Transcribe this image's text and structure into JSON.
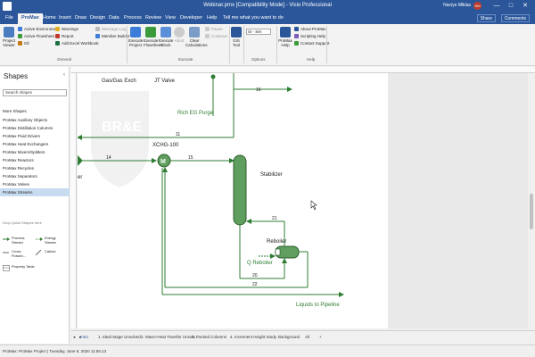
{
  "titlebar": {
    "title": "Webinar.pmx [Compatibility Mode] - Visio Professional",
    "user": "Naciye Miklas",
    "avatar_initials": "NM",
    "min_glyph": "—",
    "max_glyph": "□",
    "close_glyph": "✕"
  },
  "tabs": [
    "File",
    "ProMax",
    "Home",
    "Insert",
    "Draw",
    "Design",
    "Data",
    "Process",
    "Review",
    "View",
    "Developer",
    "Help"
  ],
  "tellme": "Tell me what you want to do",
  "share_label": "Share",
  "comments_label": "Comments",
  "ribbon": {
    "project_viewer": "Project Viewer",
    "active_environment": "Active Environment",
    "active_flowsheet": "Active Flowsheet",
    "oil": "Oil",
    "warnings": "Warnings",
    "report": "Report",
    "add_excel_workbook": "Add Excel Workbook",
    "message_log": "Message Log",
    "member_builder": "Member Builder",
    "general_label": "General",
    "execute_project": "Execute Project",
    "execute_flowsheet": "Execute Flowsheet",
    "execute_block": "Execute Block",
    "abort": "Abort",
    "clear_calculations": "Clear Calculations",
    "pause": "Pause",
    "continue": "Continue",
    "execute_label": "Execute",
    "gis_tool": "GIS Tool",
    "options_select": "SI - Set",
    "options_label": "Options",
    "promax_help": "ProMax Help",
    "about_promax": "About ProMax",
    "scripting_help": "Scripting Help",
    "contact_support": "Contact Support",
    "help_label": "Help"
  },
  "shapes_panel": {
    "title": "Shapes",
    "search_placeholder": "Search shapes",
    "more_shapes": "More Shapes",
    "stencils": [
      "ProMax Auxiliary Objects",
      "ProMax Distillation Columns",
      "ProMax Fluid Drivers",
      "ProMax Heat Exchangers",
      "ProMax Mixers/Splitters",
      "ProMax Reactors",
      "ProMax Recycles",
      "ProMax Separators",
      "ProMax Valves",
      "ProMax Streams"
    ],
    "drop_hint": "Drop Quick Shapes here",
    "master_shapes": [
      "Process Stream",
      "Energy Stream",
      "Cross Flowsh...",
      "Callout",
      "Property Table"
    ]
  },
  "diagram": {
    "labels": {
      "gas_exch": "Gas/Gas Exch",
      "jt_valve": "JT Valve",
      "rich_eg_purge": "Rich EG Purge",
      "xchg": "XCHG-100",
      "stabilizer": "Stabilizer",
      "reboiler": "Reboiler",
      "q_reboiler": "Q Reboiler",
      "liquids_to_pipeline": "Liquids to Pipeline",
      "cut_off_text": "er"
    },
    "streams": [
      "16",
      "11",
      "14",
      "15",
      "21",
      "20",
      "22"
    ],
    "exchanger_letter": "M",
    "watermark": "BR&E"
  },
  "page_tabs": [
    "Intro",
    "1. Ideal Stage Unsolved",
    "2. Mass+Heat Transfer Unsolv...",
    "3. Packed Columns",
    "4. Increment Height Study",
    "Background",
    "All"
  ],
  "page_tab_glyphs": {
    "prev": "◂",
    "next": "▸",
    "add": "+"
  },
  "statusbar": {
    "text": "ProMax: ProMax Project | Tuesday, June 9, 2020 11:55:13"
  },
  "colors": {
    "ribbon_blue": "#2b579a",
    "stream_green": "#2e7d32",
    "vessel_green": "#5f9e5f",
    "selected_stencil": "#c7dcf0"
  }
}
